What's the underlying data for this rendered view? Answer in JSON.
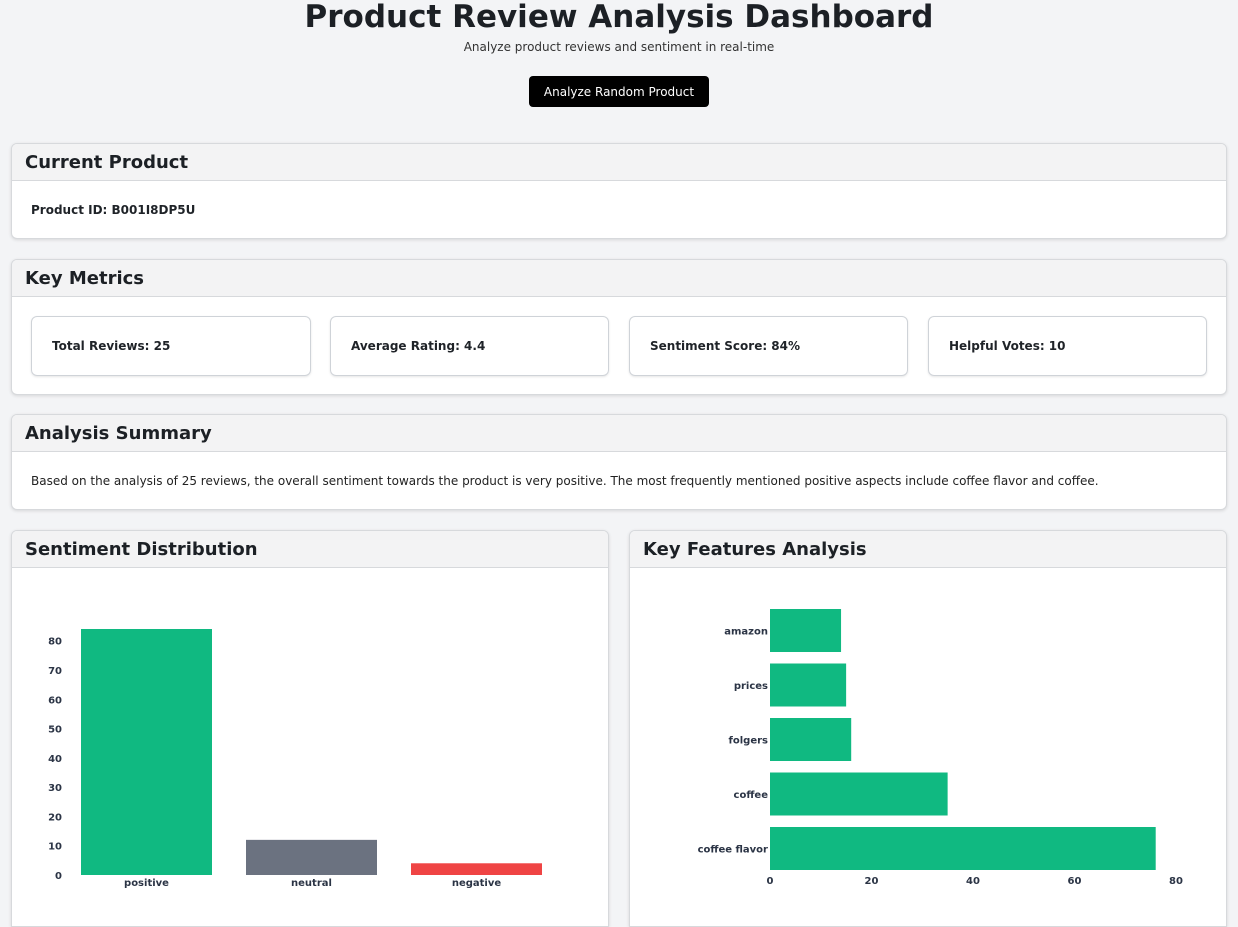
{
  "header": {
    "title": "Product Review Analysis Dashboard",
    "subtitle": "Analyze product reviews and sentiment in real-time",
    "analyze_button": "Analyze Random Product"
  },
  "current_product": {
    "heading": "Current Product",
    "product_id_text": "Product ID: B001I8DP5U"
  },
  "key_metrics": {
    "heading": "Key Metrics",
    "items": [
      {
        "text": "Total Reviews: 25"
      },
      {
        "text": "Average Rating: 4.4"
      },
      {
        "text": "Sentiment Score: 84%"
      },
      {
        "text": "Helpful Votes: 10"
      }
    ]
  },
  "analysis_summary": {
    "heading": "Analysis Summary",
    "text": "Based on the analysis of 25 reviews, the overall sentiment towards the product is very positive. The most frequently mentioned positive aspects include coffee flavor and coffee."
  },
  "sentiment_card": {
    "heading": "Sentiment Distribution"
  },
  "features_card": {
    "heading": "Key Features Analysis"
  },
  "chart_data": [
    {
      "type": "bar",
      "title": "",
      "categories": [
        "positive",
        "neutral",
        "negative"
      ],
      "values": [
        84,
        12,
        4
      ],
      "colors": [
        "#10b981",
        "#6b7280",
        "#ef4444"
      ],
      "ylim": [
        0,
        84
      ],
      "yticks": [
        0,
        10,
        20,
        30,
        40,
        50,
        60,
        70,
        80
      ],
      "grid": false
    },
    {
      "type": "bar",
      "orientation": "horizontal",
      "title": "",
      "categories": [
        "amazon",
        "prices",
        "folgers",
        "coffee",
        "coffee flavor"
      ],
      "values": [
        14,
        15,
        16,
        35,
        76
      ],
      "colors": [
        "#10b981"
      ],
      "xlim": [
        0,
        80
      ],
      "xticks": [
        0,
        20,
        40,
        60,
        80
      ],
      "grid": false
    }
  ]
}
